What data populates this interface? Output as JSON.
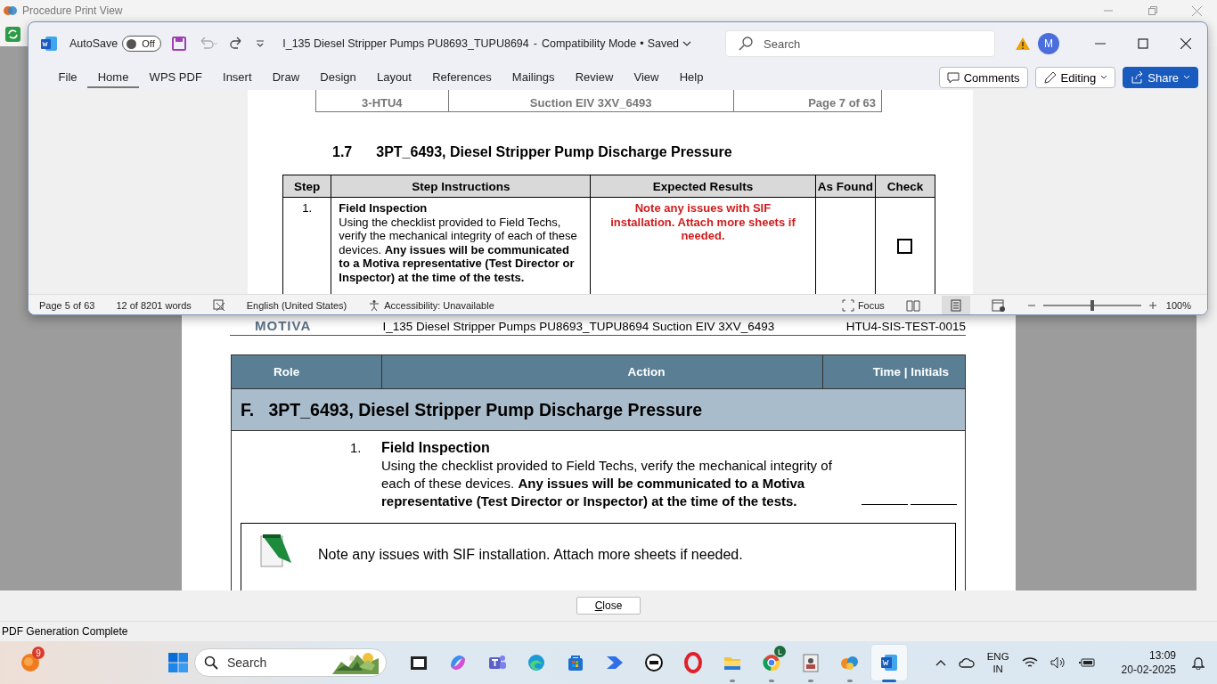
{
  "back_window": {
    "title": "Procedure Print View",
    "close_button": "Close",
    "status": "PDF Generation Complete",
    "document": {
      "logo": "MOTIVA",
      "header_title": "I_135 Diesel Stripper Pumps PU8693_TUPU8694 Suction EIV 3XV_6493",
      "doc_id": "HTU4-SIS-TEST-0015",
      "table": {
        "columns": [
          "Role",
          "Action",
          "Time | Initials"
        ],
        "section_letter": "F.",
        "section_title": "3PT_6493, Diesel Stripper Pump Discharge Pressure",
        "step": {
          "number": "1.",
          "title": "Field Inspection",
          "text": "Using the checklist provided to Field Techs, verify the mechanical integrity of each of these devices. **Any issues will be communicated to a Motiva representative (Test Director or Inspector) at the time of the tests.**"
        },
        "note": "Note any issues with SIF installation. Attach more sheets if needed."
      }
    }
  },
  "word": {
    "autosave": {
      "label": "AutoSave",
      "on": false,
      "state": "Off"
    },
    "file_name": "I_135 Diesel Stripper Pumps PU8693_TUPU8694",
    "title_separators": [
      "-",
      "•"
    ],
    "mode": "Compatibility Mode",
    "save_state": "Saved",
    "search": {
      "placeholder": "Search"
    },
    "avatar": "M",
    "tabs": [
      {
        "label": "File",
        "selected": false
      },
      {
        "label": "Home",
        "selected": true
      },
      {
        "label": "WPS PDF",
        "selected": false
      },
      {
        "label": "Insert",
        "selected": false
      },
      {
        "label": "Draw",
        "selected": false
      },
      {
        "label": "Design",
        "selected": false
      },
      {
        "label": "Layout",
        "selected": false
      },
      {
        "label": "References",
        "selected": false
      },
      {
        "label": "Mailings",
        "selected": false
      },
      {
        "label": "Review",
        "selected": false
      },
      {
        "label": "View",
        "selected": false
      },
      {
        "label": "Help",
        "selected": false
      }
    ],
    "buttons": {
      "comments": "Comments",
      "editing": "Editing",
      "share": "Share"
    },
    "document": {
      "header_cells": [
        "3-HTU4",
        "Suction EIV 3XV_6493",
        "Page 7 of 63"
      ],
      "heading_number": "1.7",
      "heading": "3PT_6493, Diesel Stripper Pump Discharge Pressure",
      "table": {
        "columns": [
          "Step",
          "Step Instructions",
          "Expected Results",
          "As Found",
          "Check"
        ],
        "rows": [
          {
            "step": "1.",
            "title": "Field Inspection",
            "text": "Using the checklist provided to Field Techs, verify the mechanical integrity of each of these devices. **Any issues will be communicated to a Motiva representative (Test Director or Inspector) at the time of the tests.**",
            "expected": "Note any issues with SIF installation. Attach more sheets if needed.",
            "checked": false
          }
        ]
      }
    },
    "status_bar": {
      "page": "Page 5 of 63",
      "words": "12 of 8201 words",
      "language": "English (United States)",
      "accessibility": "Accessibility: Unavailable",
      "focus": "Focus",
      "zoom": "100%",
      "zoom_slider": {
        "level": 0.5
      }
    }
  },
  "taskbar": {
    "widget_badge": "9",
    "search": {
      "placeholder": "Search"
    },
    "apps": [
      {
        "kind": "terminal",
        "running": false,
        "selected": false
      },
      {
        "kind": "copilot",
        "running": false,
        "selected": false
      },
      {
        "kind": "teams",
        "running": false,
        "selected": false
      },
      {
        "kind": "edge",
        "running": false,
        "selected": false
      },
      {
        "kind": "store",
        "running": false,
        "selected": false
      },
      {
        "kind": "automate",
        "running": false,
        "selected": false
      },
      {
        "kind": "dell",
        "running": false,
        "selected": false
      },
      {
        "kind": "opera",
        "running": false,
        "selected": false
      },
      {
        "kind": "explorer",
        "running": true,
        "selected": false
      },
      {
        "kind": "chrome",
        "running": true,
        "selected": false,
        "badge": "L"
      },
      {
        "kind": "contact",
        "running": true,
        "selected": false
      },
      {
        "kind": "blobs",
        "running": true,
        "selected": false
      },
      {
        "kind": "word",
        "running": true,
        "selected": true
      }
    ],
    "language": [
      "ENG",
      "IN"
    ],
    "time": "13:09",
    "date": "20-02-2025"
  }
}
